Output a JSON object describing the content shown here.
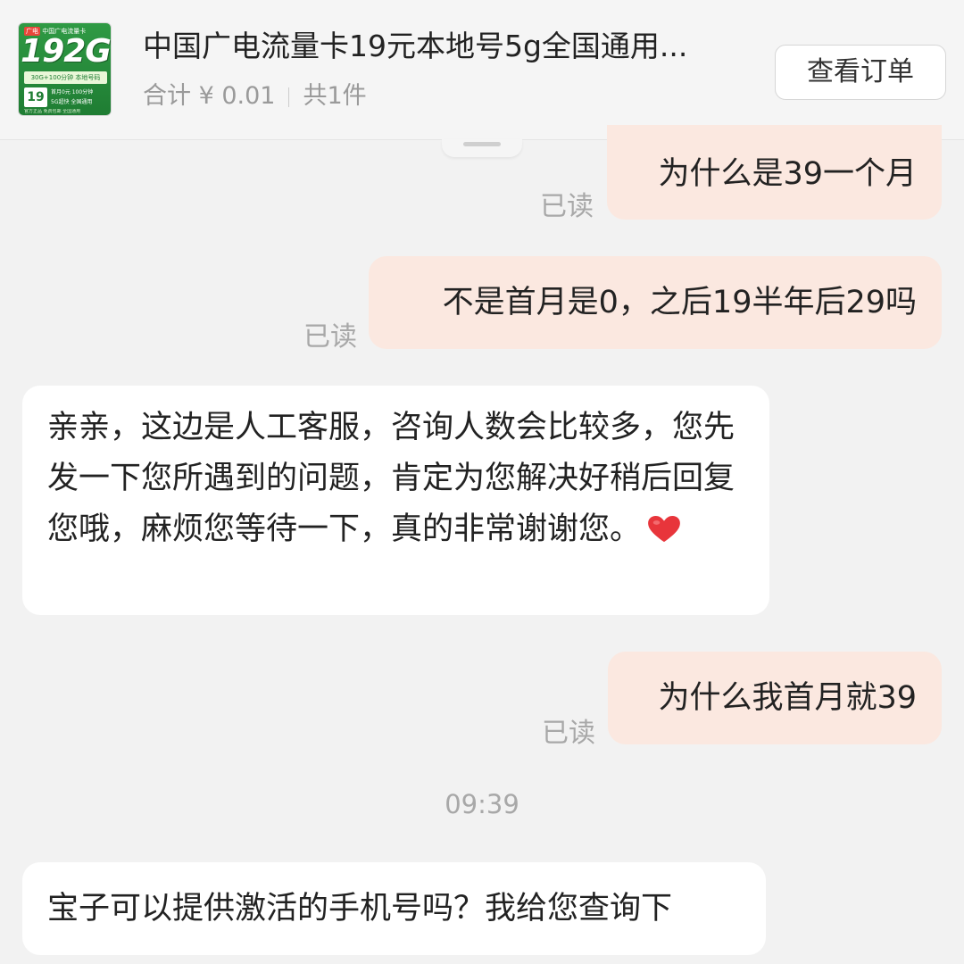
{
  "order": {
    "thumb": {
      "tag": "广电",
      "top_text": "中国广电流量卡",
      "big_text": "192G",
      "band_text": "30G+100分钟 本地号码",
      "price": "19",
      "info_line1": "首月0元 100分钟",
      "info_line2": "5G超快 全国通用",
      "foot_text": "官方正品 免费包邮 全国通用"
    },
    "title": "中国广电流量卡19元本地号5g全国通用...",
    "total": "合计 ¥ 0.01",
    "count": "共1件",
    "view_button": "查看订单"
  },
  "messages": [
    {
      "text": "为什么是39一个月",
      "status": "已读"
    },
    {
      "text": "不是首月是0，之后19半年后29吗",
      "status": "已读"
    },
    {
      "text": "亲亲，这边是人工客服，咨询人数会比较多，您先发一下您所遇到的问题，肯定为您解决好稍后回复您哦，麻烦您等待一下，真的非常谢谢您。"
    },
    {
      "text": "为什么我首月就39",
      "status": "已读"
    },
    {
      "timestamp": "09:39"
    },
    {
      "text": "宝子可以提供激活的手机号吗？我给您查询下"
    }
  ],
  "colors": {
    "outgoing_bubble": "#fbe8e0",
    "incoming_bubble": "#ffffff",
    "background": "#f2f2f2",
    "thumb_green": "#2f9a44",
    "heart": "#e8353b"
  },
  "icons": {
    "reaction": "red-heart-icon"
  }
}
